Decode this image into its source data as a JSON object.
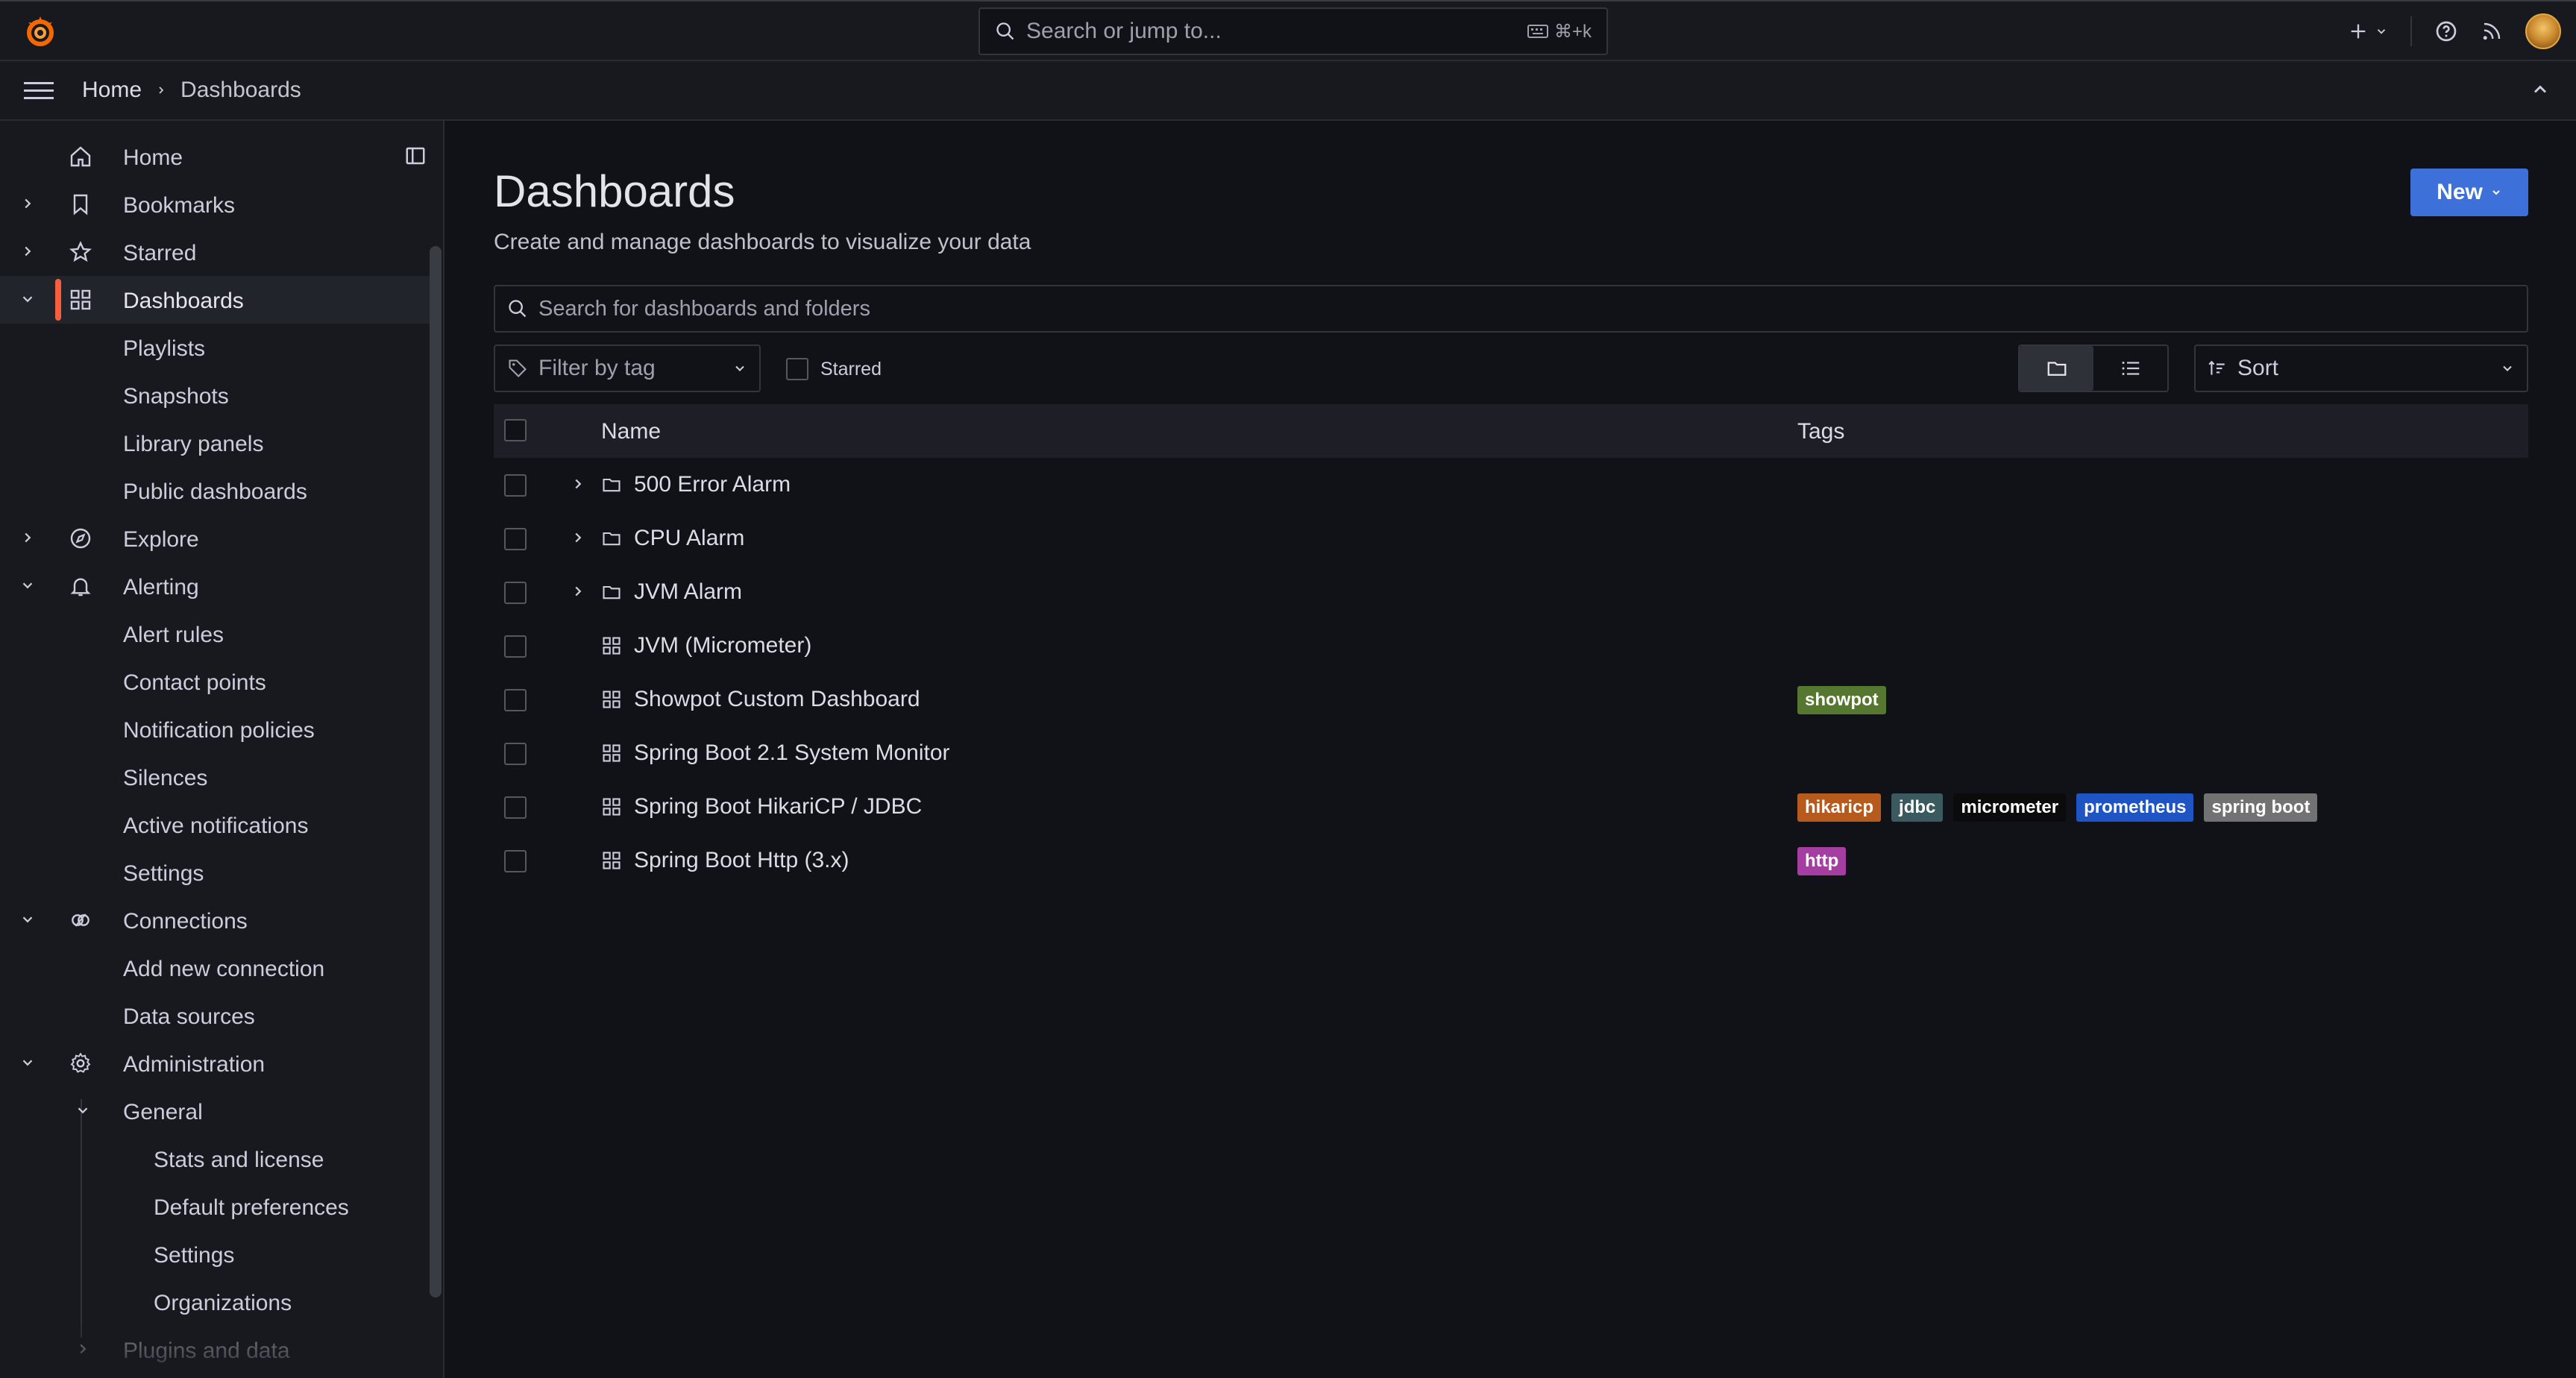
{
  "topbar": {
    "search_placeholder": "Search or jump to...",
    "search_shortcut": "⌘+k"
  },
  "breadcrumb": {
    "home": "Home",
    "current": "Dashboards"
  },
  "sidebar": {
    "items": [
      {
        "label": "Home"
      },
      {
        "label": "Bookmarks"
      },
      {
        "label": "Starred"
      },
      {
        "label": "Dashboards"
      },
      {
        "label": "Playlists"
      },
      {
        "label": "Snapshots"
      },
      {
        "label": "Library panels"
      },
      {
        "label": "Public dashboards"
      },
      {
        "label": "Explore"
      },
      {
        "label": "Alerting"
      },
      {
        "label": "Alert rules"
      },
      {
        "label": "Contact points"
      },
      {
        "label": "Notification policies"
      },
      {
        "label": "Silences"
      },
      {
        "label": "Active notifications"
      },
      {
        "label": "Settings"
      },
      {
        "label": "Connections"
      },
      {
        "label": "Add new connection"
      },
      {
        "label": "Data sources"
      },
      {
        "label": "Administration"
      },
      {
        "label": "General"
      },
      {
        "label": "Stats and license"
      },
      {
        "label": "Default preferences"
      },
      {
        "label": "Settings"
      },
      {
        "label": "Organizations"
      },
      {
        "label": "Plugins and data"
      }
    ]
  },
  "main": {
    "title": "Dashboards",
    "subtitle": "Create and manage dashboards to visualize your data",
    "new_label": "New",
    "search_placeholder": "Search for dashboards and folders",
    "filter_tag_placeholder": "Filter by tag",
    "starred_label": "Starred",
    "sort_label": "Sort",
    "columns": {
      "name": "Name",
      "tags": "Tags"
    },
    "rows": [
      {
        "name": "500 Error Alarm",
        "type": "folder",
        "tags": []
      },
      {
        "name": "CPU Alarm",
        "type": "folder",
        "tags": []
      },
      {
        "name": "JVM Alarm",
        "type": "folder",
        "tags": []
      },
      {
        "name": "JVM (Micrometer)",
        "type": "dashboard",
        "tags": []
      },
      {
        "name": "Showpot Custom Dashboard",
        "type": "dashboard",
        "tags": [
          "showpot"
        ]
      },
      {
        "name": "Spring Boot 2.1 System Monitor",
        "type": "dashboard",
        "tags": []
      },
      {
        "name": "Spring Boot HikariCP / JDBC",
        "type": "dashboard",
        "tags": [
          "hikaricp",
          "jdbc",
          "micrometer",
          "prometheus",
          "spring boot"
        ]
      },
      {
        "name": "Spring Boot Http (3.x)",
        "type": "dashboard",
        "tags": [
          "http"
        ]
      }
    ],
    "tag_colors": {
      "showpot": "#56772f",
      "hikaricp": "#b65a1d",
      "jdbc": "#3b5a5f",
      "micrometer": "#0b0b0b",
      "prometheus": "#1f54c4",
      "spring boot": "#727272",
      "http": "#a43ea0"
    }
  },
  "colors": {
    "accent": "#3d71d9",
    "active_indicator": "#f55f3e"
  }
}
